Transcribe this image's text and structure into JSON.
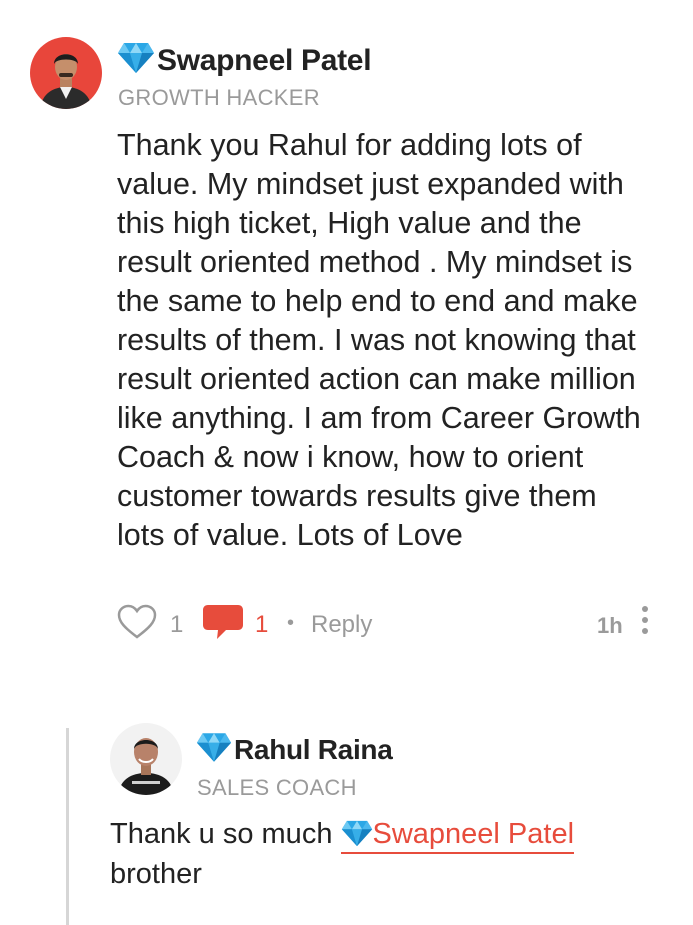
{
  "comment": {
    "author": "Swapneel Patel",
    "role": "GROWTH HACKER",
    "lines": [
      "Thank you Rahul for adding lots of",
      "value. My mindset just expanded with",
      "this high ticket, High value and  the",
      "result oriented method . My mindset is",
      "the same to help end to end and make",
      "results of them. I was not knowing that",
      "result oriented action can make million",
      "like anything. I am from Career Growth",
      "Coach & now i know, how to orient",
      "customer towards results give them",
      "lots of value. Lots of Love"
    ],
    "like_count": "1",
    "reply_count": "1",
    "separator": "•",
    "reply_label": "Reply",
    "time": "1h"
  },
  "reply": {
    "author": "Rahul Raina",
    "role": "SALES COACH",
    "text_before": "Thank u so much ",
    "mention": "Swapneel Patel",
    "text_after": "brother"
  },
  "colors": {
    "accent_red": "#e74c3c",
    "muted_gray": "#9a9a9a",
    "diamond_blue": "#2ba7e6",
    "avatar_red": "#e8463b"
  }
}
